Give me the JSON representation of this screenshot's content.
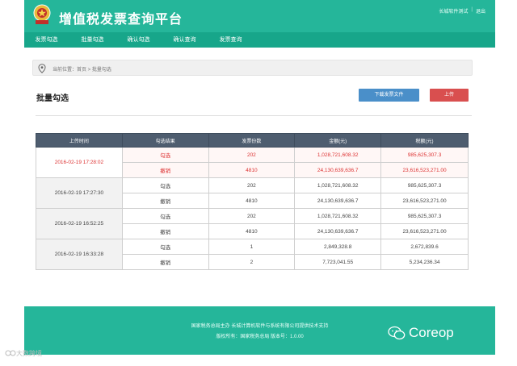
{
  "header": {
    "title": "增值税发票查询平台",
    "links": [
      "长城软件测试",
      "退出"
    ]
  },
  "nav": {
    "items": [
      "发票勾选",
      "批量勾选",
      "确认勾选",
      "确认查询",
      "发票查询"
    ]
  },
  "breadcrumb": {
    "text": "当前位置：首页 > 批量勾选"
  },
  "section": {
    "title": "批量勾选",
    "download_label": "下载发票文件",
    "upload_label": "上传"
  },
  "table": {
    "headers": [
      "上传时间",
      "勾选结果",
      "发票份数",
      "金额(元)",
      "税额(元)"
    ],
    "groups": [
      {
        "time": "2016-02-19 17:28:02",
        "highlight": true,
        "rows": [
          {
            "result": "勾选",
            "count": "202",
            "amount": "1,028,721,608.32",
            "tax": "985,625,307.3"
          },
          {
            "result": "撤销",
            "count": "4810",
            "amount": "24,130,639,636.7",
            "tax": "23,616,523,271.00"
          }
        ]
      },
      {
        "time": "2016-02-19 17:27:30",
        "highlight": false,
        "rows": [
          {
            "result": "勾选",
            "count": "202",
            "amount": "1,028,721,608.32",
            "tax": "985,625,307.3"
          },
          {
            "result": "撤销",
            "count": "4810",
            "amount": "24,130,639,636.7",
            "tax": "23,616,523,271.00"
          }
        ]
      },
      {
        "time": "2016-02-19 16:52:25",
        "highlight": false,
        "rows": [
          {
            "result": "勾选",
            "count": "202",
            "amount": "1,028,721,608.32",
            "tax": "985,625,307.3"
          },
          {
            "result": "撤销",
            "count": "4810",
            "amount": "24,130,639,636.7",
            "tax": "23,616,523,271.00"
          }
        ]
      },
      {
        "time": "2016-02-19 16:33:28",
        "highlight": false,
        "rows": [
          {
            "result": "勾选",
            "count": "1",
            "amount": "2,849,328.8",
            "tax": "2,672,839.6"
          },
          {
            "result": "撤销",
            "count": "2",
            "amount": "7,723,041.55",
            "tax": "5,234,236.34"
          }
        ]
      }
    ]
  },
  "footer": {
    "line1": "国家税务总局主办 长城计算机软件与系统有限公司提供技术支持",
    "line2": "版权所有：国家税务总局 版本号：1.0.00"
  },
  "watermark": {
    "right": "Coreop",
    "left": "大数跨境"
  },
  "colors": {
    "brand": "#25b69a",
    "nav": "#17a68a",
    "table_header": "#4e5d6f",
    "download": "#4a8fc9",
    "upload": "#d94f4f",
    "highlight_text": "#dd3333"
  }
}
